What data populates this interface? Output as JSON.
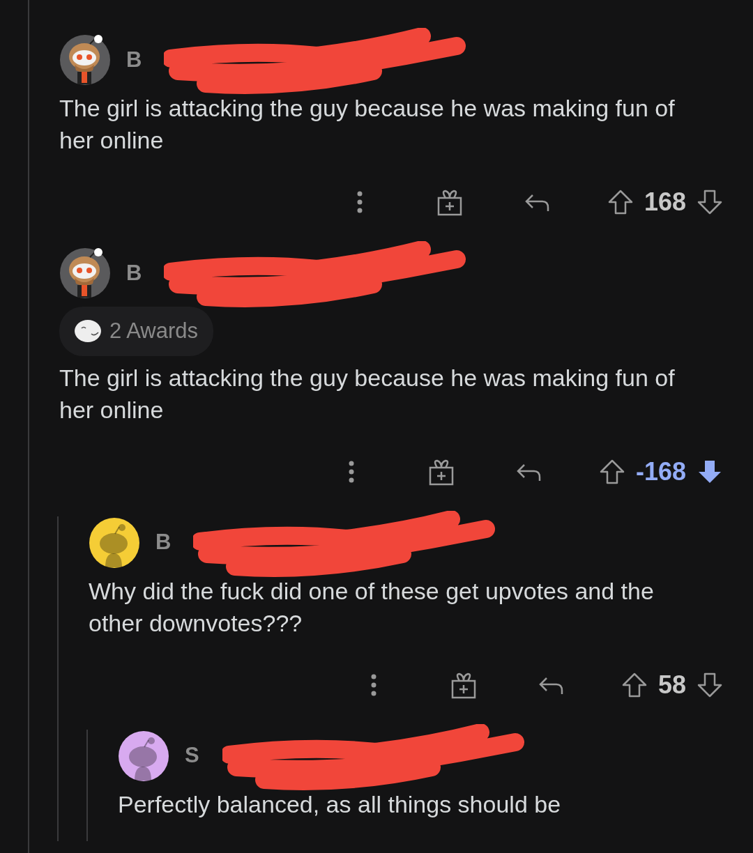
{
  "comments": [
    {
      "author": "B",
      "avatar": {
        "kind": "custom"
      },
      "body": "The girl is attacking the guy because he was making fun of her online",
      "score": "168",
      "upvoted": false,
      "downvoted": false
    },
    {
      "author": "B",
      "avatar": {
        "kind": "custom"
      },
      "awards": "2 Awards",
      "body": "The girl is attacking the guy because he was making fun of her online",
      "score": "-168",
      "upvoted": false,
      "downvoted": true,
      "children": [
        {
          "author": "B",
          "avatar": {
            "kind": "snoo",
            "color": "#f5cd36"
          },
          "body": "Why did the fuck did one of these get upvotes and the other downvotes???",
          "score": "58",
          "upvoted": false,
          "downvoted": false,
          "children": [
            {
              "author": "S",
              "avatar": {
                "kind": "snoo",
                "color": "#d8aaf0"
              },
              "body": "Perfectly balanced, as all things should be"
            }
          ]
        }
      ]
    }
  ]
}
